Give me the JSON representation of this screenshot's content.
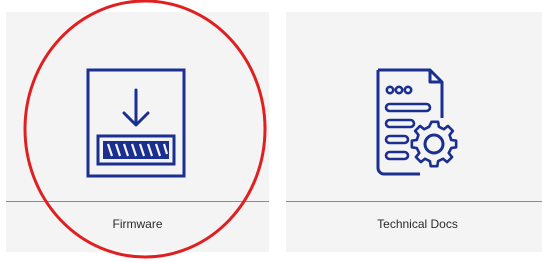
{
  "cards": [
    {
      "label": "Firmware",
      "icon": "firmware-download-icon"
    },
    {
      "label": "Technical Docs",
      "icon": "technical-docs-gear-icon"
    }
  ],
  "colors": {
    "card_background": "#f4f4f4",
    "icon_blue": "#1a2f8f",
    "divider": "#8a8a8a",
    "label_text": "#2a2a2a",
    "annotation_red": "#e02020"
  }
}
